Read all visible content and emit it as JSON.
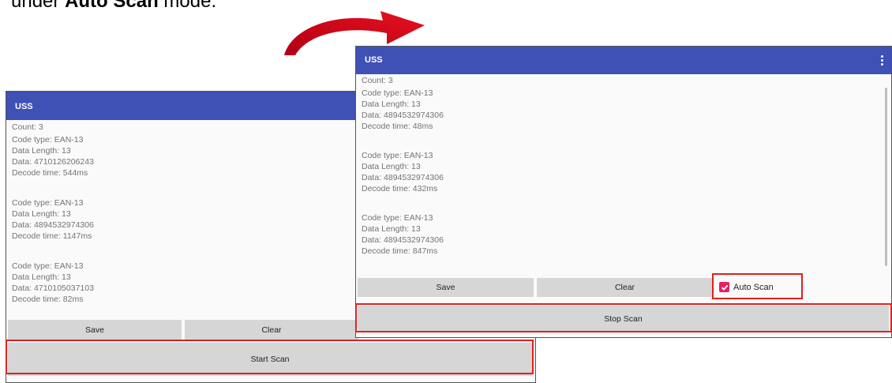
{
  "caption": {
    "prefix": "under ",
    "bold": "Auto Scan",
    "suffix": " mode."
  },
  "left_screen": {
    "app_title": "USS",
    "count_label": "Count:  3",
    "records": [
      {
        "code_type": "Code type: EAN-13",
        "data_length": "Data Length: 13",
        "data": "Data: 4710126206243",
        "decode_time": "Decode time: 544ms"
      },
      {
        "code_type": "Code type: EAN-13",
        "data_length": "Data Length: 13",
        "data": "Data: 4894532974306",
        "decode_time": "Decode time: 1147ms"
      },
      {
        "code_type": "Code type: EAN-13",
        "data_length": "Data Length: 13",
        "data": "Data: 4710105037103",
        "decode_time": "Decode time: 82ms"
      }
    ],
    "save_label": "Save",
    "clear_label": "Clear",
    "scan_label": "Start Scan"
  },
  "right_screen": {
    "app_title": "USS",
    "count_label": "Count:  3",
    "records": [
      {
        "code_type": "Code type: EAN-13",
        "data_length": "Data Length: 13",
        "data": "Data: 4894532974306",
        "decode_time": "Decode time: 48ms"
      },
      {
        "code_type": "Code type: EAN-13",
        "data_length": "Data Length: 13",
        "data": "Data: 4894532974306",
        "decode_time": "Decode time: 432ms"
      },
      {
        "code_type": "Code type: EAN-13",
        "data_length": "Data Length: 13",
        "data": "Data: 4894532974306",
        "decode_time": "Decode time: 847ms"
      }
    ],
    "save_label": "Save",
    "clear_label": "Clear",
    "auto_scan_label": "Auto Scan",
    "auto_scan_checked": true,
    "scan_label": "Stop Scan"
  },
  "colors": {
    "appbar": "#3f51b5",
    "highlight": "#e02020",
    "checkbox": "#e91e63",
    "arrow": "#d0021b"
  },
  "icons": {
    "menu": "overflow-menu-icon",
    "check": "checkmark-icon",
    "arrow": "curved-arrow-icon"
  }
}
